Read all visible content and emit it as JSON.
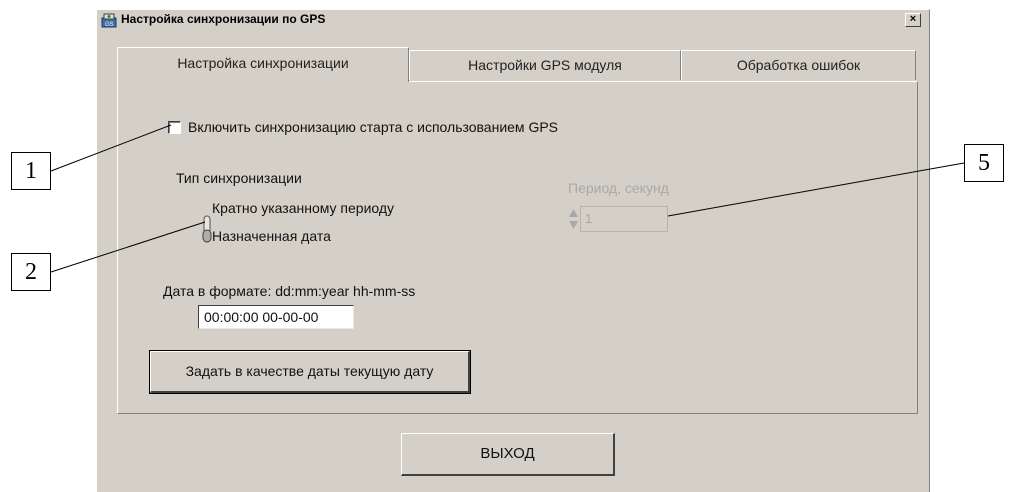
{
  "window": {
    "title": "Настройка синхронизации по GPS",
    "close_glyph": "×"
  },
  "tabs": [
    {
      "label": "Настройка синхронизации",
      "active": true
    },
    {
      "label": "Настройки GPS модуля",
      "active": false
    },
    {
      "label": "Обработка ошибок",
      "active": false
    }
  ],
  "sync": {
    "enable_label": "Включить синхронизацию старта с использованием GPS",
    "enable_checked": false,
    "type_label": "Тип синхронизации",
    "option_period": "Кратно указанному периоду",
    "option_date": "Назначенная дата",
    "selected_option": "Назначенная дата",
    "period_label": "Период, секунд",
    "period_value": "1",
    "date_format_label": "Дата в формате: dd:mm:year hh-mm-ss",
    "date_value": "00:00:00 00-00-00",
    "set_current_date_button": "Задать в качестве даты текущую дату"
  },
  "exit_button": "ВЫХОД",
  "callouts": [
    "1",
    "2",
    "5"
  ],
  "icons": {
    "title": "gps-app-icon",
    "close": "close-icon",
    "toggle": "toggle-switch-icon",
    "spinner": "spinner-arrows-icon"
  },
  "colors": {
    "window_bg": "#d4d0c8",
    "disabled_text": "#a8a8a8"
  }
}
